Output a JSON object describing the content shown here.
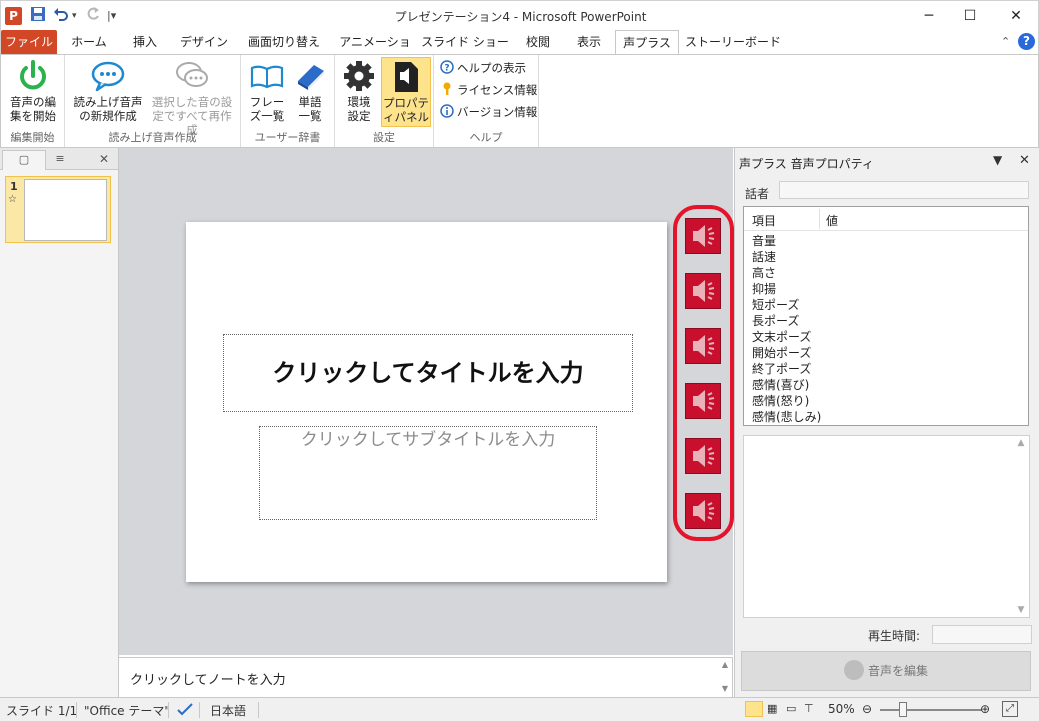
{
  "window": {
    "title": "プレゼンテーション4 - Microsoft PowerPoint",
    "app_icon_letter": "P"
  },
  "tabs": [
    {
      "label": "ファイル"
    },
    {
      "label": "ホーム"
    },
    {
      "label": "挿入"
    },
    {
      "label": "デザイン"
    },
    {
      "label": "画面切り替え"
    },
    {
      "label": "アニメーション"
    },
    {
      "label": "スライド ショー"
    },
    {
      "label": "校閲"
    },
    {
      "label": "表示"
    },
    {
      "label": "声プラス"
    },
    {
      "label": "ストーリーボード"
    }
  ],
  "active_tab": "声プラス",
  "ribbon": {
    "groups": {
      "edit_start": "編集開始",
      "create": "読み上げ音声作成",
      "dictionary": "ユーザー辞書",
      "settings": "設定",
      "help": "ヘルプ"
    },
    "buttons": {
      "start_edit": "音声の編集を開始",
      "new_voice": "読み上げ音声の新規作成",
      "regen_selected": "選択した音の設定ですべて再作成",
      "phrase_list": "フレーズ一覧",
      "word_list": "単語一覧",
      "env_settings": "環境設定",
      "property_panel": "プロパティパネル",
      "show_help": "ヘルプの表示",
      "license_info": "ライセンス情報",
      "version_info": "バージョン情報"
    }
  },
  "thumbnail_pane": {
    "slide_number": "1",
    "star": "☆"
  },
  "slide": {
    "title_placeholder": "クリックしてタイトルを入力",
    "subtitle_placeholder": "クリックしてサブタイトルを入力"
  },
  "speaker_icons": 6,
  "notes": {
    "placeholder": "クリックしてノートを入力"
  },
  "task_pane": {
    "title": "声プラス 音声プロパティ",
    "speaker_label": "話者",
    "table": {
      "col_item": "項目",
      "col_value": "値",
      "rows": [
        "音量",
        "話速",
        "高さ",
        "抑揚",
        "短ポーズ",
        "長ポーズ",
        "文末ポーズ",
        "開始ポーズ",
        "終了ポーズ",
        "感情(喜び)",
        "感情(怒り)",
        "感情(悲しみ)"
      ]
    },
    "playtime_label": "再生時間:",
    "edit_voice_button": "音声を編集"
  },
  "statusbar": {
    "slide_info": "スライド 1/1",
    "theme": "\"Office テーマ\"",
    "language": "日本語",
    "zoom": "50%"
  },
  "colors": {
    "file_tab": "#d24726",
    "speaker_icon_bg": "#c8102e",
    "highlight_ring": "#e3142b",
    "ribbon_highlight": "#fde38c"
  }
}
